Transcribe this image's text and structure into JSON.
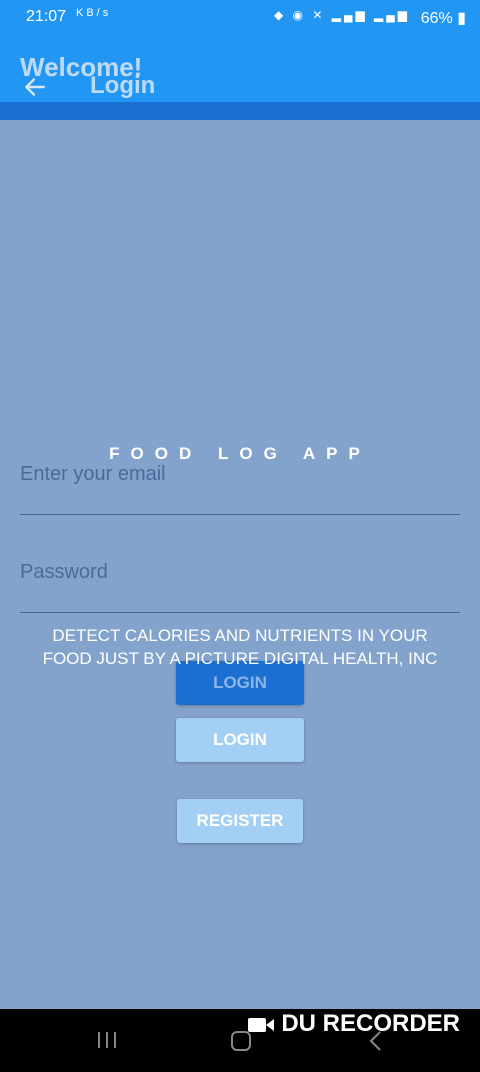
{
  "status_bar": {
    "time": "21:07",
    "left_icons": "KB/s",
    "right_icons": "",
    "battery": "66%"
  },
  "app_bar": {
    "welcome_title": "Welcome!",
    "login_title": "Login"
  },
  "main": {
    "app_name": "FOOD LOG APP",
    "email_placeholder": "Enter your email",
    "password_placeholder": "Password",
    "tagline": "DETECT CALORIES AND NUTRIENTS IN YOUR FOOD JUST BY A PICTURE DIGITAL HEALTH, INC",
    "login_button_dark": "LOGIN",
    "login_button_light": "LOGIN",
    "register_button": "REGISTER"
  },
  "overlay": {
    "recorder_label": "DU RECORDER"
  },
  "colors": {
    "primary": "#2196f3",
    "primary_dark": "#1b6fd0",
    "background": "#84a3cc",
    "button_light": "#a4cff5"
  }
}
